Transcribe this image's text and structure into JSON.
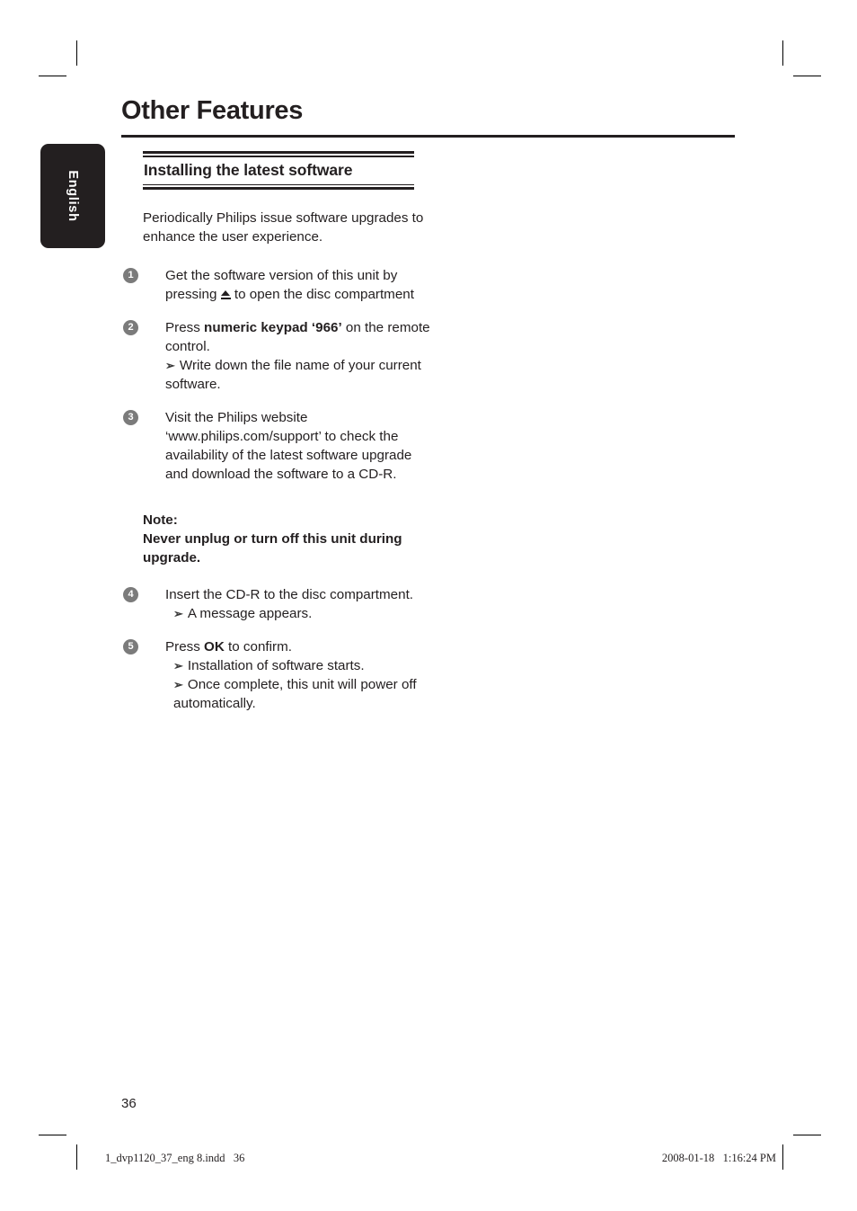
{
  "page": {
    "chapter_title": "Other Features",
    "section_heading": "Installing the latest software",
    "page_number": "36",
    "language_tab": "English",
    "colors": {
      "ink": "#231f20",
      "step_bullet": "#7b7b7b",
      "tab_background": "#231f20",
      "tab_text": "#ffffff"
    }
  },
  "intro": {
    "paragraph": "Periodically Philips issue software upgrades to enhance the user experience."
  },
  "steps": [
    {
      "number": "1",
      "text_before_icon": "Get the software version of this unit by pressing ",
      "icon": "eject-icon",
      "text_after_icon": " to open the disc compartment",
      "sub_items": []
    },
    {
      "number": "2",
      "text_prefix": "Press ",
      "emphasis": "numeric keypad ‘966’",
      "text_suffix": " on the remote control.",
      "sub_items": [
        "Write down the file name of your current software."
      ]
    },
    {
      "number": "3",
      "text": "Visit the Philips website ‘www.philips.com/support’ to check the availability of the latest software upgrade and download the software to a CD-R.",
      "sub_items": []
    },
    {
      "number": "4",
      "text": "Insert the CD-R to the disc compartment.",
      "sub_items": [
        "A message appears."
      ]
    },
    {
      "number": "5",
      "text_prefix": "Press ",
      "emphasis": "OK",
      "text_suffix": " to confirm.",
      "sub_items": [
        "Installation of software starts.",
        "Once complete, this unit will power off automatically."
      ]
    }
  ],
  "note": {
    "label": "Note:",
    "body": "Never unplug or turn off this unit during upgrade."
  },
  "footer": {
    "left": "1_dvp1120_37_eng 8.indd   36",
    "right": "2008-01-18   1:16:24 PM"
  }
}
